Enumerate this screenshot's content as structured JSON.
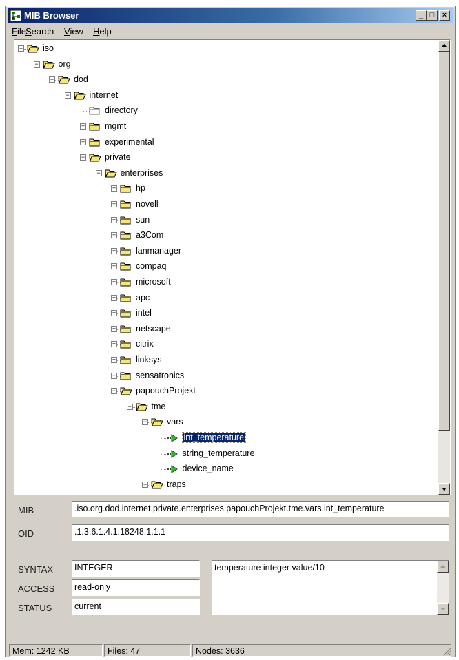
{
  "window": {
    "title": "MIB Browser",
    "minimize": "_",
    "maximize": "□",
    "close": "×"
  },
  "menu": [
    {
      "label": "File",
      "hotkey": "F"
    },
    {
      "label": "Search",
      "hotkey": "S"
    },
    {
      "label": "View",
      "hotkey": "V"
    },
    {
      "label": "Help",
      "hotkey": "H"
    }
  ],
  "tree": {
    "nodes": [
      {
        "label": "iso",
        "level": 0,
        "expander": "minus",
        "icon": "open-folder"
      },
      {
        "label": "org",
        "level": 1,
        "expander": "minus",
        "icon": "open-folder"
      },
      {
        "label": "dod",
        "level": 2,
        "expander": "minus",
        "icon": "open-folder"
      },
      {
        "label": "internet",
        "level": 3,
        "expander": "minus",
        "icon": "open-folder"
      },
      {
        "label": "directory",
        "level": 4,
        "expander": "none",
        "icon": "empty-folder"
      },
      {
        "label": "mgmt",
        "level": 4,
        "expander": "plus",
        "icon": "folder"
      },
      {
        "label": "experimental",
        "level": 4,
        "expander": "plus",
        "icon": "folder"
      },
      {
        "label": "private",
        "level": 4,
        "expander": "minus",
        "icon": "open-folder"
      },
      {
        "label": "enterprises",
        "level": 5,
        "expander": "minus",
        "icon": "open-folder"
      },
      {
        "label": "hp",
        "level": 6,
        "expander": "plus",
        "icon": "folder"
      },
      {
        "label": "novell",
        "level": 6,
        "expander": "plus",
        "icon": "folder"
      },
      {
        "label": "sun",
        "level": 6,
        "expander": "plus",
        "icon": "folder"
      },
      {
        "label": "a3Com",
        "level": 6,
        "expander": "plus",
        "icon": "folder"
      },
      {
        "label": "lanmanager",
        "level": 6,
        "expander": "plus",
        "icon": "folder"
      },
      {
        "label": "compaq",
        "level": 6,
        "expander": "plus",
        "icon": "folder"
      },
      {
        "label": "microsoft",
        "level": 6,
        "expander": "plus",
        "icon": "folder"
      },
      {
        "label": "apc",
        "level": 6,
        "expander": "plus",
        "icon": "folder"
      },
      {
        "label": "intel",
        "level": 6,
        "expander": "plus",
        "icon": "folder"
      },
      {
        "label": "netscape",
        "level": 6,
        "expander": "plus",
        "icon": "folder"
      },
      {
        "label": "citrix",
        "level": 6,
        "expander": "plus",
        "icon": "folder"
      },
      {
        "label": "linksys",
        "level": 6,
        "expander": "plus",
        "icon": "folder"
      },
      {
        "label": "sensatronics",
        "level": 6,
        "expander": "plus",
        "icon": "folder"
      },
      {
        "label": "papouchProjekt",
        "level": 6,
        "expander": "minus",
        "icon": "open-folder"
      },
      {
        "label": "tme",
        "level": 7,
        "expander": "minus",
        "icon": "open-folder"
      },
      {
        "label": "vars",
        "level": 8,
        "expander": "minus",
        "icon": "open-folder"
      },
      {
        "label": "int_temperature",
        "level": 9,
        "expander": "none",
        "icon": "green-arrow",
        "selected": true
      },
      {
        "label": "string_temperature",
        "level": 9,
        "expander": "none",
        "icon": "green-arrow"
      },
      {
        "label": "device_name",
        "level": 9,
        "expander": "none",
        "icon": "green-arrow"
      },
      {
        "label": "traps",
        "level": 8,
        "expander": "minus",
        "icon": "open-folder"
      }
    ]
  },
  "details": {
    "mib_label": "MIB",
    "mib_value": ".iso.org.dod.internet.private.enterprises.papouchProjekt.tme.vars.int_temperature",
    "oid_label": "OID",
    "oid_value": ".1.3.6.1.4.1.18248.1.1.1",
    "syntax_label": "SYNTAX",
    "syntax_value": "INTEGER",
    "access_label": "ACCESS",
    "access_value": "read-only",
    "status_label": "STATUS",
    "status_value": "current",
    "description": "temperature integer value/10"
  },
  "statusbar": {
    "mem": "Mem: 1242 KB",
    "files": "Files: 47",
    "nodes": "Nodes: 3636"
  },
  "colors": {
    "folder": "#f5e67a",
    "selection": "#0a246a",
    "arrow": "#2fb82f",
    "titlebar": "#0a246a"
  }
}
